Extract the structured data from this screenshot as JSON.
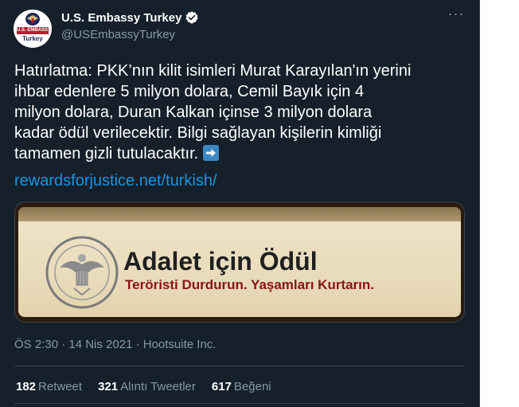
{
  "tweet": {
    "avatar": {
      "band_text": "U.S. EMBASSY",
      "country_text": "Turkey"
    },
    "display_name": "U.S. Embassy Turkey",
    "handle": "@USEmbassyTurkey",
    "more_label": "···",
    "body_lines": [
      "Hatırlatma: PKK’nın kilit isimleri Murat Karayılan'ın yerini",
      "ihbar edenlere 5 milyon dolara, Cemil Bayık için 4",
      "milyon dolara, Duran Kalkan içinse 3 milyon dolara",
      "kadar ödül verilecektir.  Bilgi sağlayan kişilerin kimliği",
      "tamamen gizli tutulacaktır."
    ],
    "link": "rewardsforjustice.net/turkish/",
    "card": {
      "title": "Adalet için Ödül",
      "subtitle": "Teröristi Durdurun. Yaşamları Kurtarın.",
      "seal_text": "DEPARTMENT OF STATE · UNITED STATES OF AMERICA"
    },
    "meta": "ÖS 2:30 · 14 Nis 2021 · Hootsuite Inc.",
    "stats": [
      {
        "count": "182",
        "label": "Retweet"
      },
      {
        "count": "321",
        "label": "Alıntı Tweetler"
      },
      {
        "count": "617",
        "label": "Beğeni"
      }
    ]
  },
  "colors": {
    "background": "#15202b",
    "text": "#ffffff",
    "secondary_text": "#8899a6",
    "link": "#1b95e0",
    "verified": "#1da1f2",
    "divider": "#38444d",
    "card_subtitle": "#8b1313"
  },
  "icons": [
    "verified-badge-icon",
    "more-options-icon",
    "right-arrow-emoji-icon",
    "department-of-state-seal-icon"
  ]
}
